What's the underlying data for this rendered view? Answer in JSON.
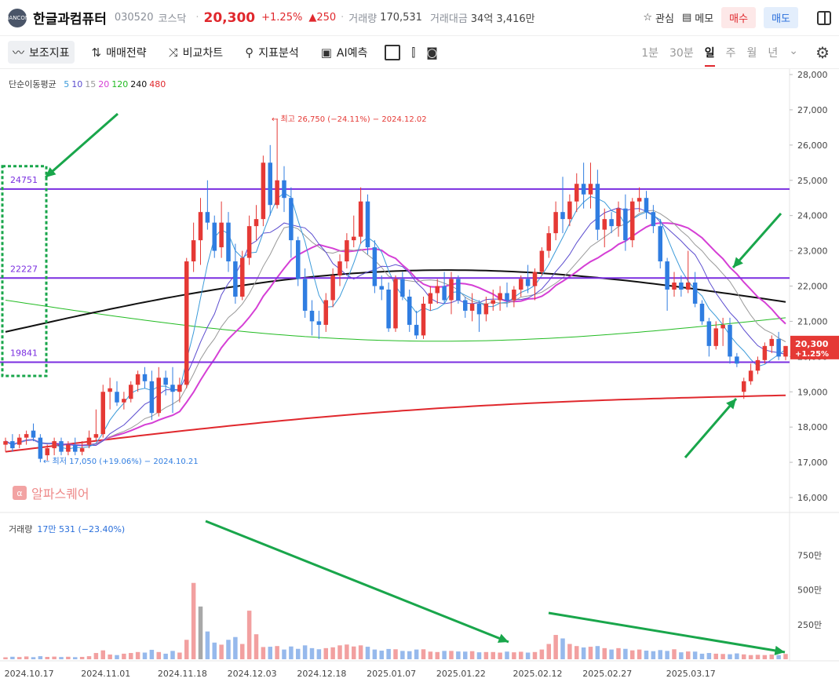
{
  "header": {
    "logo_text": "HANCOM",
    "name": "한글과컴퓨터",
    "code": "030520",
    "market": "코스닥",
    "price": "20,300",
    "change_rate": "+1.25%",
    "change": "▲250",
    "volume_label": "거래량",
    "volume": "170,531",
    "amount_label": "거래대금",
    "amount": "34억 3,416만",
    "watch_label": "관심",
    "memo_label": "메모",
    "buy_label": "매수",
    "sell_label": "매도"
  },
  "toolbar": {
    "items": [
      "보조지표",
      "매매전략",
      "비교차트",
      "지표분석",
      "AI예측"
    ],
    "periods": [
      "1분",
      "30분",
      "일",
      "주",
      "월",
      "년"
    ],
    "selected_period": "일"
  },
  "indicator_legend": {
    "label": "단순이동평균",
    "periods": [
      {
        "text": "5",
        "color": "#3a9ad9"
      },
      {
        "text": "10",
        "color": "#5b4ccf"
      },
      {
        "text": "15",
        "color": "#999999"
      },
      {
        "text": "20",
        "color": "#d53fd5"
      },
      {
        "text": "120",
        "color": "#22bb22"
      },
      {
        "text": "240",
        "color": "#111111"
      },
      {
        "text": "480",
        "color": "#e0282d"
      }
    ]
  },
  "volume_legend": {
    "label": "거래량",
    "value": "17만 531 (−23.40%)"
  },
  "watermark": {
    "icon": "α",
    "text": "알파스퀘어"
  },
  "colors": {
    "up": "#e53935",
    "down": "#2f7de1",
    "up_vol": "#f2a0a0",
    "down_vol": "#96b9ec",
    "level": "#7a2ee0",
    "price_tag": "#e53935"
  },
  "chart_data": {
    "type": "candlestick",
    "y_range": [
      16000,
      28000
    ],
    "y_ticks": [
      "16,000",
      "17,000",
      "18,000",
      "19,000",
      "20,000",
      "21,000",
      "22,000",
      "23,000",
      "24,000",
      "25,000",
      "26,000",
      "27,000",
      "28,000"
    ],
    "x_tick_labels": [
      "2024.10.17",
      "2024.11.01",
      "2024.11.18",
      "2024.12.03",
      "2024.12.18",
      "2025.01.07",
      "2025.01.22",
      "2025.02.12",
      "2025.02.27",
      "2025.03.17"
    ],
    "horizontal_levels": [
      24751,
      22227,
      19841
    ],
    "current_price_tag": {
      "price": "20,300",
      "rate": "+1.25%"
    },
    "high_annotation": "최고 26,750 (−24.11%) − 2024.12.02",
    "low_annotation": "최저 17,050 (+19.06%) − 2024.10.21",
    "candles": [
      [
        17500,
        17700,
        17300,
        17600
      ],
      [
        17600,
        17800,
        17300,
        17400
      ],
      [
        17500,
        17800,
        17400,
        17700
      ],
      [
        17700,
        17900,
        17500,
        17800
      ],
      [
        17900,
        18100,
        17600,
        17700
      ],
      [
        17700,
        17800,
        17000,
        17100
      ],
      [
        17200,
        17500,
        17050,
        17400
      ],
      [
        17400,
        17700,
        17200,
        17600
      ],
      [
        17600,
        17700,
        17200,
        17300
      ],
      [
        17300,
        17600,
        17200,
        17500
      ],
      [
        17500,
        17700,
        17200,
        17300
      ],
      [
        17300,
        17600,
        17200,
        17400
      ],
      [
        17500,
        17900,
        17400,
        17700
      ],
      [
        17700,
        18500,
        17600,
        17800
      ],
      [
        17800,
        19200,
        17700,
        19000
      ],
      [
        19000,
        19400,
        18500,
        19100
      ],
      [
        19000,
        19300,
        18600,
        18700
      ],
      [
        18700,
        19000,
        18500,
        18800
      ],
      [
        18800,
        19300,
        18700,
        19200
      ],
      [
        19200,
        19600,
        19000,
        19500
      ],
      [
        19500,
        19700,
        19100,
        19300
      ],
      [
        19300,
        19600,
        18200,
        18400
      ],
      [
        18400,
        19700,
        18300,
        19400
      ],
      [
        19400,
        19600,
        18900,
        19200
      ],
      [
        19200,
        19700,
        18400,
        19000
      ],
      [
        19000,
        19400,
        18700,
        19200
      ],
      [
        19200,
        22800,
        19100,
        22700
      ],
      [
        22700,
        23800,
        22400,
        23300
      ],
      [
        23300,
        24500,
        22600,
        24100
      ],
      [
        24100,
        25000,
        23600,
        23800
      ],
      [
        23800,
        24000,
        22800,
        23000
      ],
      [
        23100,
        24400,
        22800,
        23800
      ],
      [
        23800,
        24100,
        22400,
        22700
      ],
      [
        22700,
        23200,
        21500,
        21700
      ],
      [
        21700,
        23000,
        21600,
        22800
      ],
      [
        22800,
        24000,
        22600,
        23700
      ],
      [
        23700,
        24300,
        23300,
        23900
      ],
      [
        23900,
        25700,
        23700,
        25500
      ],
      [
        25500,
        26000,
        24000,
        24300
      ],
      [
        24300,
        26750,
        24200,
        25000
      ],
      [
        25000,
        25400,
        24100,
        24500
      ],
      [
        24500,
        24800,
        22800,
        23300
      ],
      [
        23300,
        23400,
        22000,
        22200
      ],
      [
        22200,
        22500,
        21100,
        21300
      ],
      [
        21300,
        21600,
        20600,
        21000
      ],
      [
        21000,
        21300,
        20500,
        20900
      ],
      [
        20900,
        21800,
        20700,
        21600
      ],
      [
        21600,
        22500,
        21400,
        22300
      ],
      [
        22300,
        22900,
        22000,
        22700
      ],
      [
        22700,
        23500,
        22500,
        23300
      ],
      [
        23300,
        24000,
        23100,
        23400
      ],
      [
        23400,
        24800,
        23200,
        24400
      ],
      [
        24400,
        24600,
        22900,
        23100
      ],
      [
        23100,
        23300,
        21800,
        22000
      ],
      [
        22000,
        22300,
        21600,
        21900
      ],
      [
        21900,
        22100,
        20700,
        20800
      ],
      [
        20800,
        22300,
        20700,
        22200
      ],
      [
        22200,
        22400,
        21600,
        21700
      ],
      [
        21700,
        21900,
        20700,
        20900
      ],
      [
        20900,
        21300,
        20500,
        20600
      ],
      [
        20600,
        21700,
        20500,
        21500
      ],
      [
        21500,
        22000,
        21300,
        21800
      ],
      [
        21800,
        22200,
        21500,
        22000
      ],
      [
        22000,
        22400,
        21500,
        21600
      ],
      [
        21600,
        22400,
        21200,
        22200
      ],
      [
        22200,
        22300,
        21500,
        21600
      ],
      [
        21600,
        21700,
        21100,
        21300
      ],
      [
        21300,
        21800,
        21000,
        21500
      ],
      [
        21500,
        21600,
        20700,
        21200
      ],
      [
        21200,
        21700,
        21000,
        21500
      ],
      [
        21500,
        21900,
        21300,
        21600
      ],
      [
        21600,
        22000,
        21300,
        21800
      ],
      [
        21800,
        22100,
        21400,
        21600
      ],
      [
        21600,
        22000,
        21400,
        21900
      ],
      [
        21900,
        22300,
        21700,
        22200
      ],
      [
        22200,
        22600,
        21800,
        22000
      ],
      [
        22000,
        22500,
        21600,
        22400
      ],
      [
        22400,
        23100,
        22300,
        23000
      ],
      [
        23000,
        23700,
        22800,
        23500
      ],
      [
        23500,
        24400,
        23300,
        24100
      ],
      [
        24100,
        25100,
        23500,
        23900
      ],
      [
        23900,
        24600,
        23700,
        24400
      ],
      [
        24400,
        25200,
        24100,
        24900
      ],
      [
        24900,
        25500,
        24200,
        24600
      ],
      [
        24600,
        25500,
        24200,
        24900
      ],
      [
        24900,
        25300,
        23300,
        23600
      ],
      [
        23600,
        24200,
        23100,
        23900
      ],
      [
        23900,
        24100,
        23500,
        23700
      ],
      [
        23700,
        24400,
        23400,
        24200
      ],
      [
        24200,
        24600,
        23000,
        23300
      ],
      [
        23300,
        24500,
        23100,
        24400
      ],
      [
        24400,
        24800,
        24100,
        24500
      ],
      [
        24500,
        24700,
        23900,
        24100
      ],
      [
        24100,
        24300,
        23500,
        23700
      ],
      [
        23700,
        23900,
        22500,
        22700
      ],
      [
        22700,
        22800,
        21300,
        21900
      ],
      [
        21900,
        22400,
        21700,
        22100
      ],
      [
        22100,
        22300,
        21700,
        21900
      ],
      [
        21900,
        23000,
        21800,
        22100
      ],
      [
        22100,
        22400,
        21400,
        21500
      ],
      [
        21500,
        21600,
        20900,
        21000
      ],
      [
        21000,
        21100,
        20000,
        20300
      ],
      [
        20300,
        21000,
        20200,
        20800
      ],
      [
        20800,
        21100,
        20300,
        20900
      ],
      [
        20900,
        21100,
        19800,
        20000
      ],
      [
        20000,
        20100,
        19700,
        19800
      ],
      [
        19000,
        19400,
        18800,
        19300
      ],
      [
        19300,
        19800,
        19200,
        19600
      ],
      [
        19600,
        20000,
        19500,
        19900
      ],
      [
        19900,
        20400,
        19800,
        20300
      ],
      [
        20300,
        20600,
        20100,
        20500
      ],
      [
        20500,
        20700,
        19900,
        20000
      ],
      [
        20000,
        20300,
        19900,
        20300
      ]
    ],
    "volume_range_axis_labels": [
      "250만",
      "500만",
      "750만"
    ],
    "volumes": [
      14,
      18,
      16,
      20,
      15,
      22,
      17,
      19,
      16,
      18,
      15,
      17,
      22,
      45,
      64,
      34,
      30,
      40,
      45,
      52,
      48,
      68,
      52,
      40,
      60,
      48,
      140,
      550,
      380,
      200,
      120,
      105,
      140,
      160,
      110,
      350,
      180,
      88,
      90,
      95,
      70,
      92,
      75,
      100,
      80,
      72,
      80,
      86,
      100,
      106,
      92,
      100,
      90,
      70,
      62,
      74,
      72,
      60,
      58,
      70,
      72,
      55,
      52,
      60,
      60,
      56,
      55,
      58,
      50,
      52,
      52,
      48,
      55,
      50,
      54,
      48,
      52,
      70,
      110,
      175,
      150,
      110,
      95,
      85,
      90,
      95,
      80,
      70,
      80,
      75,
      64,
      70,
      62,
      58,
      66,
      60,
      72,
      50,
      56,
      55,
      40,
      45,
      40,
      38,
      36,
      42,
      35,
      30,
      32,
      30,
      34,
      30,
      38
    ],
    "moving_averages": [
      {
        "period": 5,
        "color": "#3a9ad9"
      },
      {
        "period": 10,
        "color": "#5b4ccf"
      },
      {
        "period": 15,
        "color": "#999999"
      },
      {
        "period": 20,
        "color": "#d53fd5"
      },
      {
        "period": 120,
        "color": "#22bb22"
      },
      {
        "period": 240,
        "color": "#111111"
      },
      {
        "period": 480,
        "color": "#e0282d"
      }
    ]
  }
}
